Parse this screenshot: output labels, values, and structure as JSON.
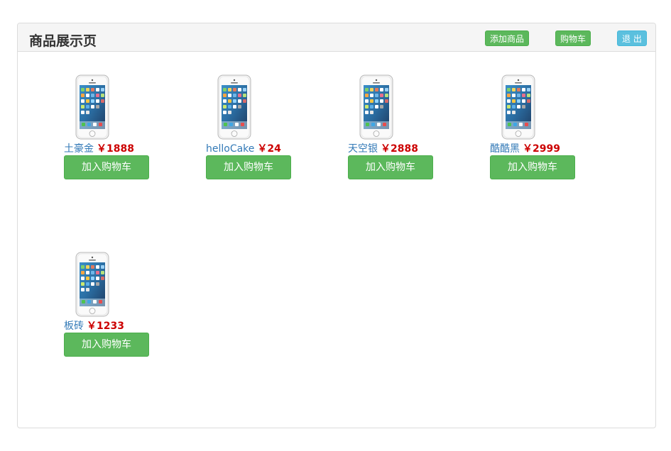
{
  "header": {
    "title": "商品展示页",
    "add_product_label": "添加商品",
    "cart_label": "购物车",
    "logout_label": "退 出"
  },
  "products": [
    {
      "name": "土豪金",
      "price": "￥1888",
      "button": "加入购物车"
    },
    {
      "name": "helloCake",
      "price": "￥24",
      "button": "加入购物车"
    },
    {
      "name": "天空银",
      "price": "￥2888",
      "button": "加入购物车"
    },
    {
      "name": "酷酷黑",
      "price": "￥2999",
      "button": "加入购物车"
    },
    {
      "name": "板砖",
      "price": "￥1233",
      "button": "加入购物车"
    }
  ],
  "colors": {
    "success": "#5cb85c",
    "info": "#5bc0de",
    "link": "#337ab7",
    "price": "#cc0000"
  }
}
